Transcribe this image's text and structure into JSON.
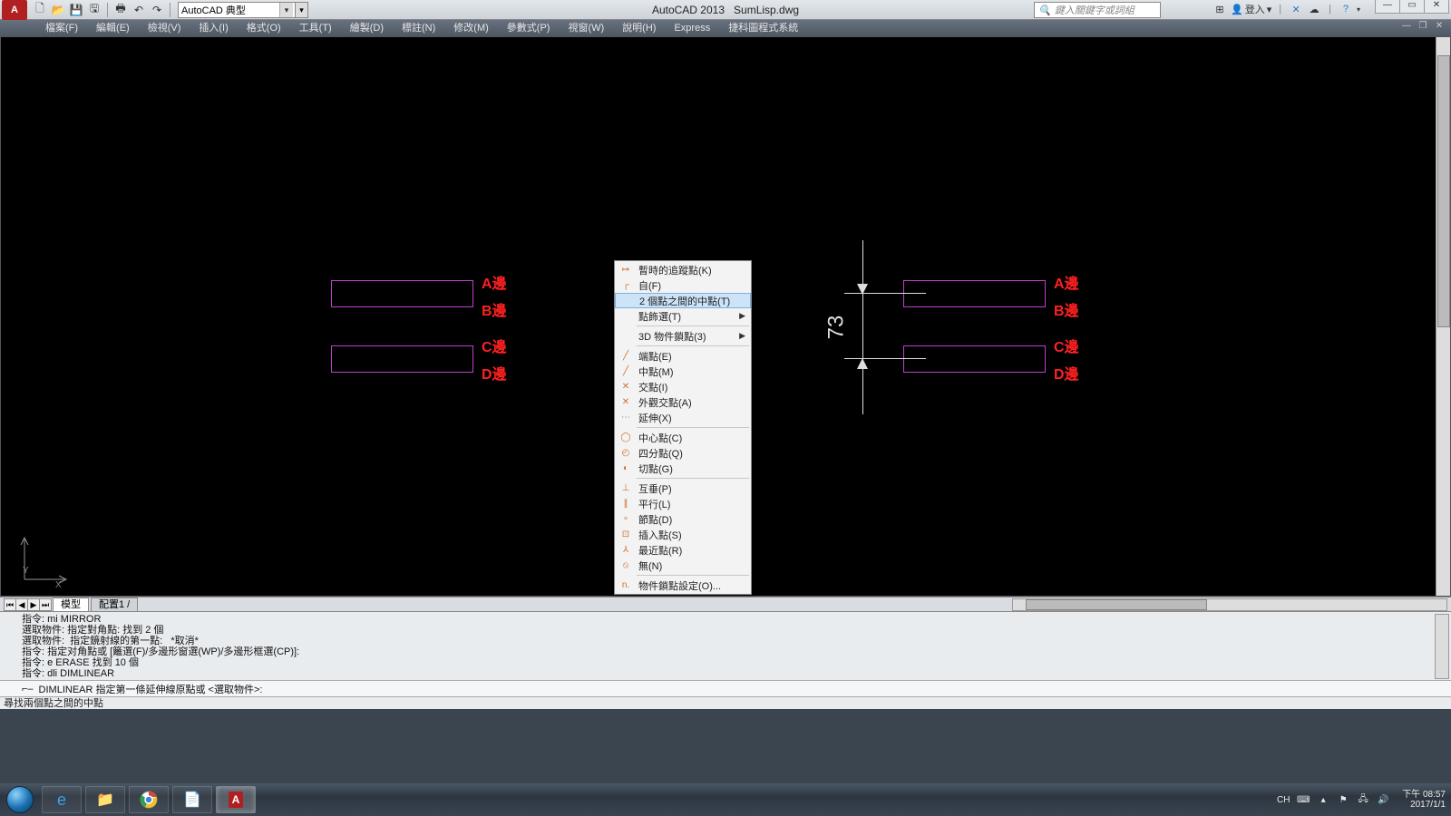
{
  "title": {
    "app": "AutoCAD 2013",
    "file": "SumLisp.dwg"
  },
  "workspace_combo": "AutoCAD 典型",
  "search_placeholder": "鍵入關鍵字或詞組",
  "signin_label": "登入",
  "menubar": [
    "檔案(F)",
    "編輯(E)",
    "檢視(V)",
    "插入(I)",
    "格式(O)",
    "工具(T)",
    "繪製(D)",
    "標註(N)",
    "修改(M)",
    "參數式(P)",
    "視窗(W)",
    "說明(H)",
    "Express",
    "捷科圖程式系統"
  ],
  "context_menu": {
    "items": [
      {
        "label": "暫時的追蹤點(K)",
        "icon": "↦"
      },
      {
        "label": "自(F)",
        "icon": "┌˙"
      },
      {
        "label": "2 個點之間的中點(T)",
        "icon": "",
        "hl": true
      },
      {
        "label": "點飾選(T)",
        "icon": "",
        "sub": true
      },
      {
        "sep": true
      },
      {
        "label": "3D 物件鎖點(3)",
        "icon": "",
        "sub": true
      },
      {
        "sep": true
      },
      {
        "label": "端點(E)",
        "icon": "╱"
      },
      {
        "label": "中點(M)",
        "icon": "╱"
      },
      {
        "label": "交點(I)",
        "icon": "✕"
      },
      {
        "label": "外觀交點(A)",
        "icon": "✕"
      },
      {
        "label": "延伸(X)",
        "icon": "⋯"
      },
      {
        "sep": true
      },
      {
        "label": "中心點(C)",
        "icon": "◯"
      },
      {
        "label": "四分點(Q)",
        "icon": "◴"
      },
      {
        "label": "切點(G)",
        "icon": "◐"
      },
      {
        "sep": true
      },
      {
        "label": "互垂(P)",
        "icon": "⊥"
      },
      {
        "label": "平行(L)",
        "icon": "∥"
      },
      {
        "label": "節點(D)",
        "icon": "∘"
      },
      {
        "label": "插入點(S)",
        "icon": "⊡"
      },
      {
        "label": "最近點(R)",
        "icon": "⅄"
      },
      {
        "label": "無(N)",
        "icon": "⦸"
      },
      {
        "sep": true
      },
      {
        "label": "物件鎖點設定(O)...",
        "icon": "n."
      }
    ]
  },
  "drawing": {
    "labels_left": [
      "A邊",
      "B邊",
      "C邊",
      "D邊"
    ],
    "labels_right": [
      "A邊",
      "B邊",
      "C邊",
      "D邊"
    ],
    "dimension_value": "73"
  },
  "tabs": {
    "model": "模型",
    "layout1": "配置1"
  },
  "command_history": "指令: mi MIRROR\n選取物件: 指定對角點: 找到 2 個\n選取物件:  指定鏡射線的第一點:   *取消*\n指令: 指定对角點或 [籬選(F)/多邊形窗選(WP)/多邊形框選(CP)]:\n指令: e ERASE 找到 10 個\n指令: dli DIMLINEAR",
  "command_line": "DIMLINEAR 指定第一條延伸線原點或 <選取物件>:",
  "status_text": "尋找兩個點之間的中點",
  "tray": {
    "ime": "CH",
    "time": "下午 08:57",
    "date": "2017/1/1"
  }
}
